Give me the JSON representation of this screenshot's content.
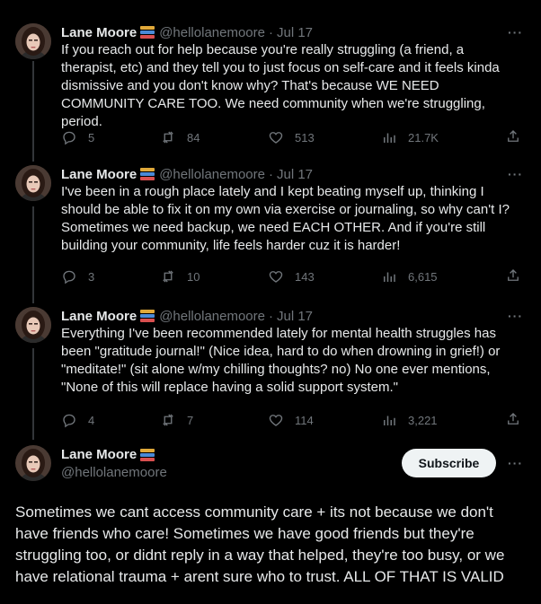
{
  "author": {
    "name": "Lane Moore",
    "handle": "@hellolanemoore",
    "badge_icon": "books-emoji-icon"
  },
  "separator": "·",
  "more_label": "···",
  "tweets": [
    {
      "date": "Jul 17",
      "text": "If you reach out for help because you're really struggling (a friend, a therapist, etc) and they tell you to just focus on self-care and it feels kinda dismissive and you don't know why? That's because WE NEED COMMUNITY CARE TOO. We need community when we're struggling, period.",
      "replies": "5",
      "retweets": "84",
      "likes": "513",
      "views": "21.7K"
    },
    {
      "date": "Jul 17",
      "text": "I've been in a rough place lately and I kept beating myself up, thinking I should be able to fix it on my own via exercise or journaling, so why can't I? Sometimes we need backup, we need EACH OTHER. And if you're still building your community, life feels harder cuz it is harder!",
      "replies": "3",
      "retweets": "10",
      "likes": "143",
      "views": "6,615"
    },
    {
      "date": "Jul 17",
      "text": "Everything I've been recommended lately for mental health struggles has been \"gratitude journal!\" (Nice idea, hard to do when drowning in grief!) or \"meditate!\" (sit alone w/my chilling thoughts? no) No one ever mentions, \"None of this will replace having a solid support system.\"",
      "replies": "4",
      "retweets": "7",
      "likes": "114",
      "views": "3,221"
    }
  ],
  "main_tweet": {
    "subscribe_label": "Subscribe",
    "text": "Sometimes we cant access community care + its not because we don't have friends who care! Sometimes we have good friends but they're struggling too, or didnt reply in a way that helped, they're too busy, or we have relational trauma + arent sure who to trust. ALL OF THAT IS VALID"
  },
  "colors": {
    "background": "#000000",
    "text": "#e7e9ea",
    "muted": "#71767b",
    "thread_line": "#333639",
    "subscribe_bg": "#eff3f4"
  }
}
